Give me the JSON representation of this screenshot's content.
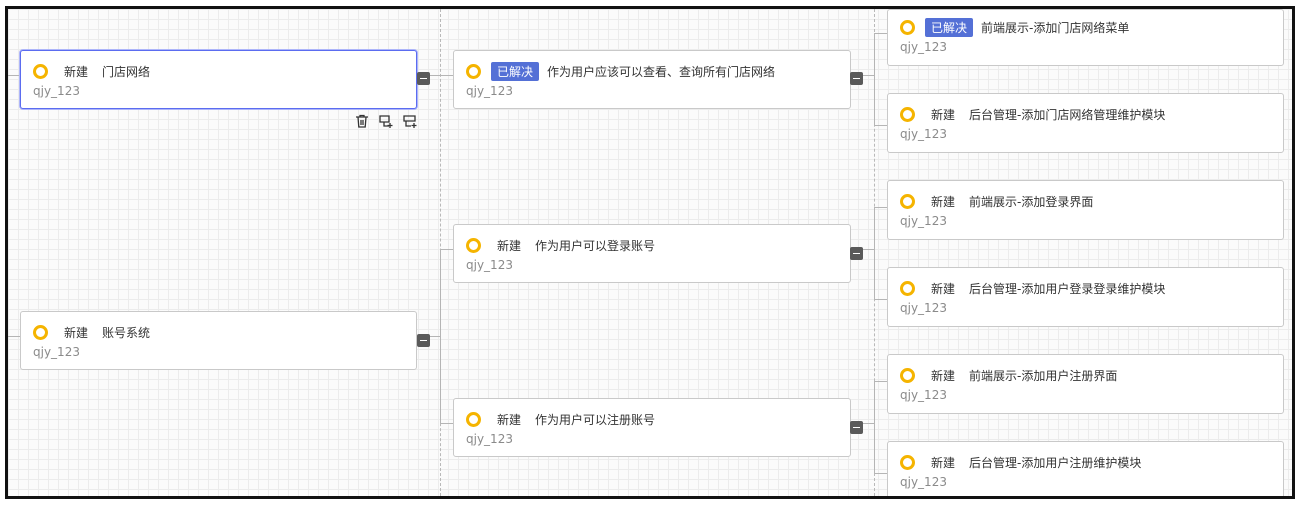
{
  "columns": {
    "level1": [
      {
        "status": "新建",
        "resolved": false,
        "title": "门店网络",
        "owner": "qjy_123",
        "selected": true
      },
      {
        "status": "新建",
        "resolved": false,
        "title": "账号系统",
        "owner": "qjy_123",
        "selected": false
      }
    ],
    "level2": [
      {
        "status": "已解决",
        "resolved": true,
        "title": "作为用户应该可以查看、查询所有门店网络",
        "owner": "qjy_123"
      },
      {
        "status": "新建",
        "resolved": false,
        "title": "作为用户可以登录账号",
        "owner": "qjy_123"
      },
      {
        "status": "新建",
        "resolved": false,
        "title": "作为用户可以注册账号",
        "owner": "qjy_123"
      }
    ],
    "level3": [
      {
        "status": "已解决",
        "resolved": true,
        "title": "前端展示-添加门店网络菜单",
        "owner": "qjy_123"
      },
      {
        "status": "新建",
        "resolved": false,
        "title": "后台管理-添加门店网络管理维护模块",
        "owner": "qjy_123"
      },
      {
        "status": "新建",
        "resolved": false,
        "title": "前端展示-添加登录界面",
        "owner": "qjy_123"
      },
      {
        "status": "新建",
        "resolved": false,
        "title": "后台管理-添加用户登录登录维护模块",
        "owner": "qjy_123"
      },
      {
        "status": "新建",
        "resolved": false,
        "title": "前端展示-添加用户注册界面",
        "owner": "qjy_123"
      },
      {
        "status": "新建",
        "resolved": false,
        "title": "后台管理-添加用户注册维护模块",
        "owner": "qjy_123"
      }
    ]
  },
  "node_toolbar": {
    "icons": [
      "delete-icon",
      "add-sibling-icon",
      "add-child-icon"
    ]
  },
  "colors": {
    "ring": "#f5b400",
    "resolved_badge": "#5470d6",
    "selected_border": "#5b6cf0"
  }
}
